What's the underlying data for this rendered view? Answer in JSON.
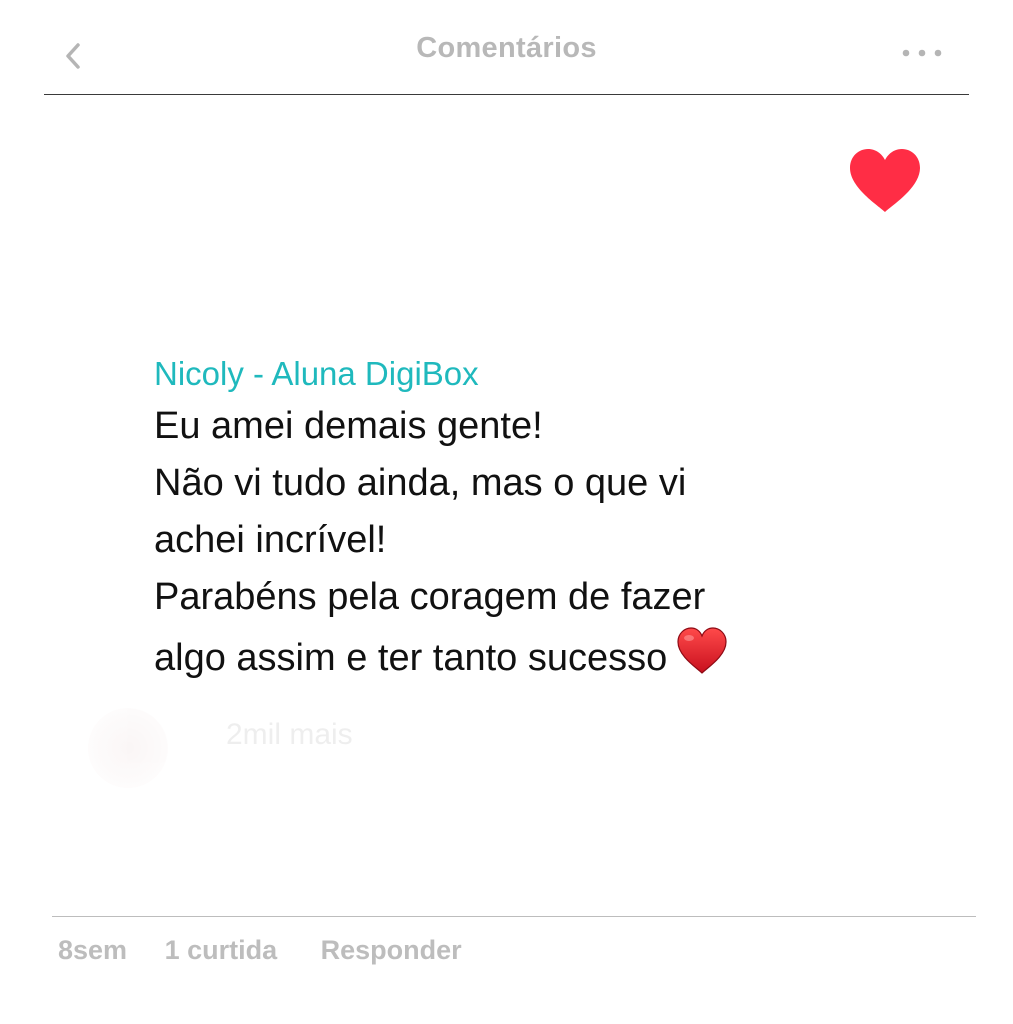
{
  "header": {
    "title": "Comentários",
    "back_icon": "chevron-left-icon",
    "more_icon": "ellipsis-icon"
  },
  "like": {
    "icon": "heart-icon",
    "color": "#ff2d45",
    "liked": true
  },
  "comment": {
    "author": "Nicoly - Aluna DigiBox",
    "author_color": "#1fb9bd",
    "lines": [
      "Eu amei demais gente!",
      "Não vi tudo ainda, mas o que vi",
      "achei incrível!",
      "Parabéns pela coragem de fazer",
      "algo assim e ter tanto sucesso"
    ],
    "emoji": "red-heart-emoji"
  },
  "background_text": "2mil mais",
  "footer": {
    "time": "8sem",
    "likes": "1 curtida",
    "reply": "Responder"
  }
}
